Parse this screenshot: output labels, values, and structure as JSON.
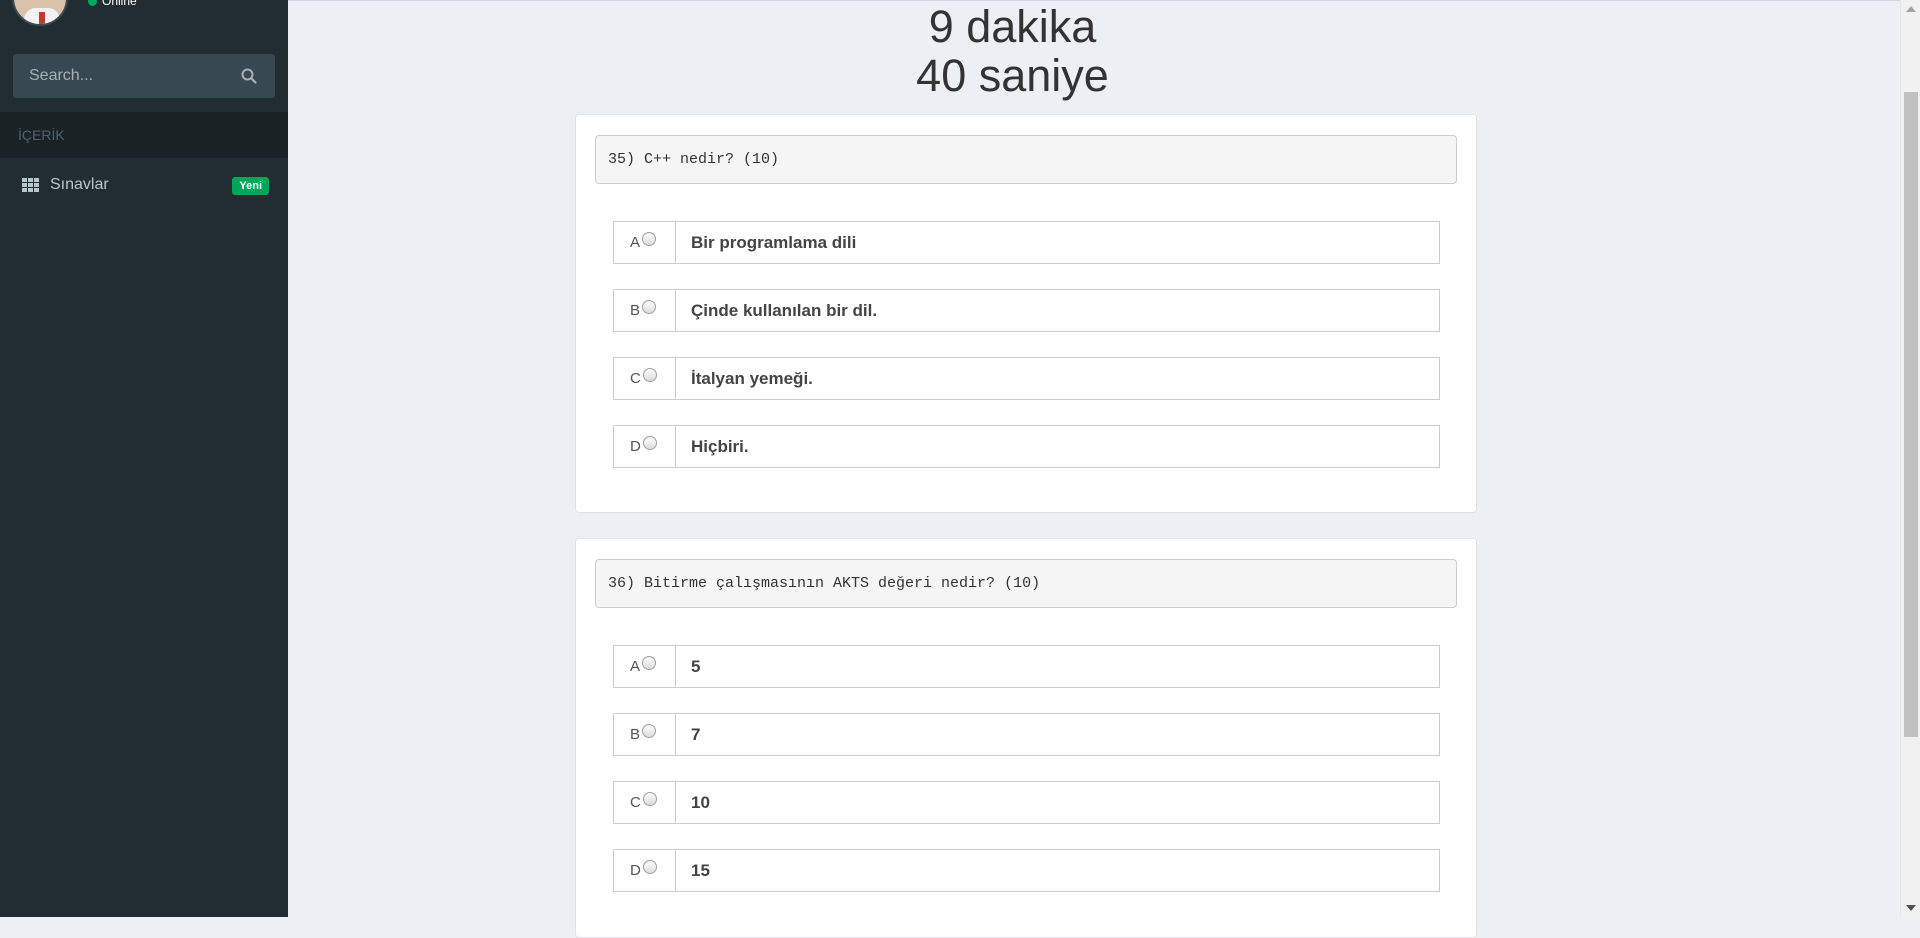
{
  "sidebar": {
    "user": {
      "status": "Online"
    },
    "search": {
      "placeholder": "Search..."
    },
    "menu_header": "İÇERİK",
    "items": [
      {
        "label": "Sınavlar",
        "badge": "Yeni",
        "icon": "grid-icon"
      }
    ]
  },
  "timer": {
    "minutes": "9 dakika",
    "seconds": "40 saniye"
  },
  "questions": [
    {
      "title": "35) C++ nedir? (10)",
      "options": [
        {
          "letter": "A",
          "text": "Bir programlama dili"
        },
        {
          "letter": "B",
          "text": "Çinde kullanılan bir dil."
        },
        {
          "letter": "C",
          "text": "İtalyan yemeği."
        },
        {
          "letter": "D",
          "text": "Hiçbiri."
        }
      ]
    },
    {
      "title": "36) Bitirme çalışmasının AKTS değeri nedir? (10)",
      "options": [
        {
          "letter": "A",
          "text": "5"
        },
        {
          "letter": "B",
          "text": "7"
        },
        {
          "letter": "C",
          "text": "10"
        },
        {
          "letter": "D",
          "text": "15"
        }
      ]
    }
  ],
  "colors": {
    "sidebar_bg": "#222d32",
    "badge_green": "#00a65a",
    "content_bg": "#ecf0f5"
  }
}
